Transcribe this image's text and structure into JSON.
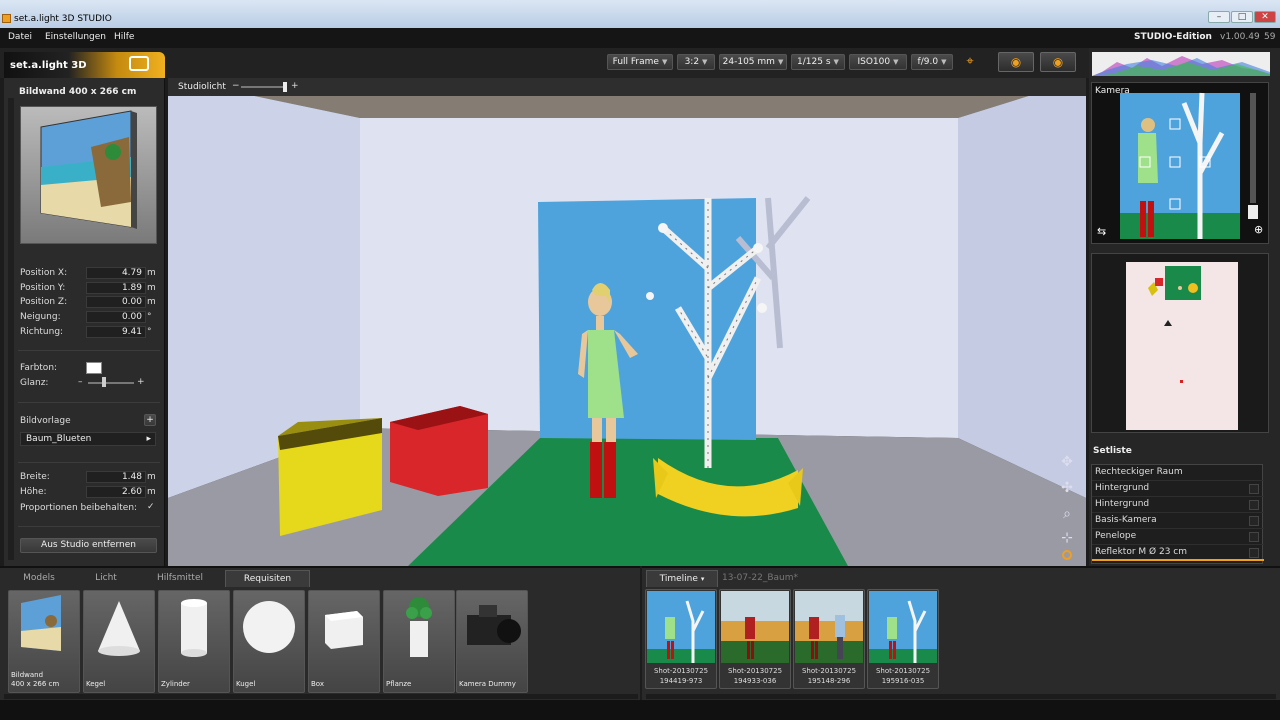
{
  "window": {
    "title": "set.a.light 3D STUDIO"
  },
  "menu": {
    "items": [
      "Datei",
      "Einstellungen",
      "Hilfe"
    ],
    "edition": "STUDIO-Edition",
    "version": "v1.00.49",
    "version_extra": "59"
  },
  "logo": {
    "text": "set.a.light 3D"
  },
  "toolbar": {
    "frame": "Full Frame",
    "ratio": "3:2",
    "lens": "24-105 mm",
    "shutter": "1/125 s",
    "iso": "ISO100",
    "aperture": "f/9.0"
  },
  "left_panel": {
    "title": "Bildwand 400 x 266 cm",
    "position_x": {
      "label": "Position X:",
      "value": "4.79",
      "unit": "m"
    },
    "position_y": {
      "label": "Position Y:",
      "value": "1.89",
      "unit": "m"
    },
    "position_z": {
      "label": "Position Z:",
      "value": "0.00",
      "unit": "m"
    },
    "neigung": {
      "label": "Neigung:",
      "value": "0.00",
      "unit": "°"
    },
    "richtung": {
      "label": "Richtung:",
      "value": "9.41",
      "unit": "°"
    },
    "farbton_label": "Farbton:",
    "glanz_label": "Glanz:",
    "bildvorlage_label": "Bildvorlage",
    "bildvorlage_value": "Baum_Blueten",
    "breite": {
      "label": "Breite:",
      "value": "1.48",
      "unit": "m"
    },
    "hoehe": {
      "label": "Höhe:",
      "value": "2.60",
      "unit": "m"
    },
    "proportionen_label": "Proportionen beibehalten:",
    "remove_button": "Aus Studio entfernen"
  },
  "viewport": {
    "studiolicht_label": "Studiolicht",
    "minus": "−",
    "plus": "+"
  },
  "right_panel": {
    "camera_label": "Kamera",
    "setliste_title": "Setliste",
    "setliste": [
      "Rechteckiger Raum",
      "Hintergrund",
      "Hintergrund",
      "Basis-Kamera",
      "Penelope",
      "Reflektor M Ø 23 cm"
    ]
  },
  "bottom_tabs": [
    "Models",
    "Licht",
    "Hilfsmittel",
    "Requisiten"
  ],
  "props": [
    {
      "label1": "Bildwand",
      "label2": "400 x 266 cm"
    },
    {
      "label1": "Kegel",
      "label2": ""
    },
    {
      "label1": "Zylinder",
      "label2": ""
    },
    {
      "label1": "Kugel",
      "label2": ""
    },
    {
      "label1": "Box",
      "label2": ""
    },
    {
      "label1": "Pflanze",
      "label2": ""
    },
    {
      "label1": "Kamera Dummy",
      "label2": ""
    }
  ],
  "timeline": {
    "tab": "Timeline",
    "session": "13-07-22_Baum*",
    "shots": [
      {
        "l1": "Shot-20130725",
        "l2": "194419-973"
      },
      {
        "l1": "Shot-20130725",
        "l2": "194933-036"
      },
      {
        "l1": "Shot-20130725",
        "l2": "195148-296"
      },
      {
        "l1": "Shot-20130725",
        "l2": "195916-035"
      }
    ]
  }
}
